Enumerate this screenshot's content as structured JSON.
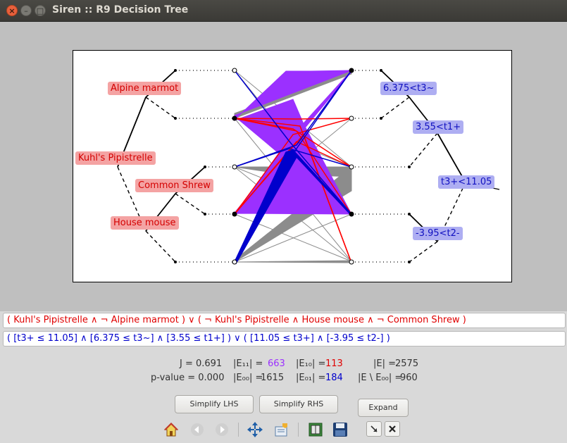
{
  "window": {
    "title": "Siren :: R9 Decision Tree"
  },
  "tree": {
    "left_labels": [
      "Alpine marmot",
      "Kuhl's Pipistrelle",
      "Common Shrew",
      "House mouse"
    ],
    "right_labels": [
      "6.375<t3~",
      "3.55<t1+",
      "t3+<11.05",
      "-3.95<t2-"
    ]
  },
  "query": {
    "lhs": "( Kuhl's Pipistrelle ∧ ¬ Alpine marmot ) ∨ ( ¬ Kuhl's Pipistrelle ∧ House mouse ∧ ¬ Common Shrew )",
    "rhs": "( [t3+ ≤ 11.05] ∧ [6.375 ≤ t3~] ∧ [3.55 ≤ t1+] ) ∨ ( [11.05 ≤ t3+] ∧ [-3.95 ≤ t2-] )"
  },
  "stats": {
    "j": "J = 0.691",
    "pvalue": "p-value = 0.000",
    "e11_label": "|E₁₁| =",
    "e11_value": "663",
    "e10_label": "|E₁₀| =",
    "e10_value": "113",
    "e_label": "|E| =",
    "e_value": "2575",
    "e00_label": "|E₀₀| =",
    "e00_value": "1615",
    "e01_label": "|E₀₁| =",
    "e01_value": "184",
    "e_minus_label": "|E \\ E₀₀| =",
    "e_minus_value": "960"
  },
  "buttons": {
    "simplify_lhs": "Simplify LHS",
    "simplify_rhs": "Simplify RHS",
    "expand": "Expand"
  },
  "toolbar": [
    "home-icon",
    "back-icon",
    "forward-icon",
    "pan-icon",
    "configure-icon",
    "subplots-icon",
    "save-icon"
  ],
  "colors": {
    "purple": "#9b30ff",
    "red": "#ff0000",
    "blue": "#0000cc",
    "gray": "#888888"
  }
}
